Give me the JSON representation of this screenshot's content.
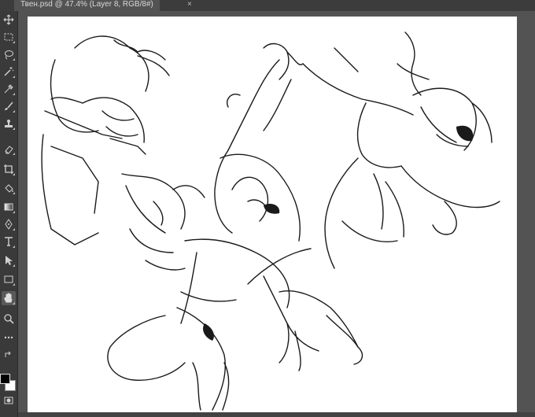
{
  "document_tab": {
    "title": "Твен.psd @ 47.4% (Layer 8, RGB/8#)",
    "close_glyph": "×"
  },
  "toolbar": {
    "tools": [
      {
        "name": "move-icon",
        "active": false
      },
      {
        "name": "marquee-icon",
        "active": false
      },
      {
        "name": "lasso-icon",
        "active": false
      },
      {
        "name": "magic-wand-icon",
        "active": false
      },
      {
        "name": "eyedropper-icon",
        "active": false
      },
      {
        "name": "brush-icon",
        "active": false
      },
      {
        "name": "stamp-icon",
        "active": false
      },
      {
        "name": "eraser-icon",
        "active": false
      },
      {
        "name": "crop-icon",
        "active": false
      },
      {
        "name": "paint-bucket-icon",
        "active": false
      },
      {
        "name": "gradient-icon",
        "active": false
      },
      {
        "name": "pen-icon",
        "active": false
      },
      {
        "name": "type-icon",
        "active": false
      },
      {
        "name": "path-selection-icon",
        "active": false
      },
      {
        "name": "rectangle-icon",
        "active": false
      },
      {
        "name": "hand-icon",
        "active": true
      },
      {
        "name": "zoom-icon",
        "active": false
      },
      {
        "name": "more-tools-icon",
        "active": false
      }
    ],
    "foreground_color": "#000000",
    "background_color": "#ffffff"
  },
  "canvas": {
    "content": "sketch-artwork",
    "background_color": "#ffffff"
  }
}
